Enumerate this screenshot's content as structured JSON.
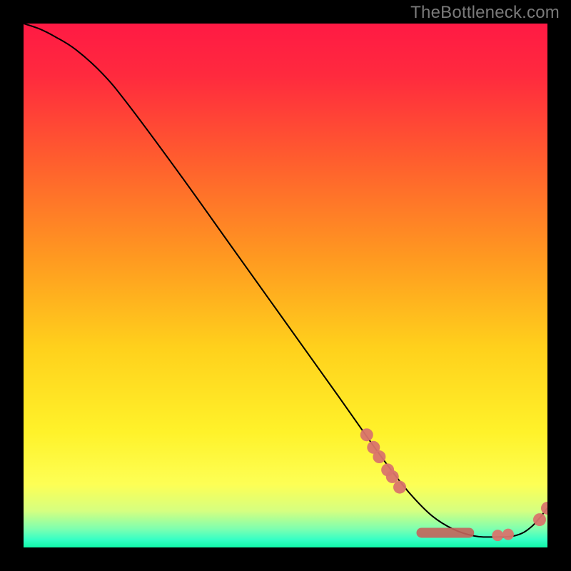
{
  "watermark": "TheBottleneck.com",
  "chart_data": {
    "type": "line",
    "title": "",
    "xlabel": "",
    "ylabel": "",
    "xlim": [
      0,
      100
    ],
    "ylim": [
      0,
      100
    ],
    "grid": false,
    "legend": false,
    "background_gradient_stops": [
      {
        "pos": 0.0,
        "color": "#ff1a44"
      },
      {
        "pos": 0.1,
        "color": "#ff2a3e"
      },
      {
        "pos": 0.25,
        "color": "#ff5a2f"
      },
      {
        "pos": 0.45,
        "color": "#ff9a20"
      },
      {
        "pos": 0.62,
        "color": "#ffd11c"
      },
      {
        "pos": 0.78,
        "color": "#fff22a"
      },
      {
        "pos": 0.88,
        "color": "#fdff55"
      },
      {
        "pos": 0.93,
        "color": "#d6ff80"
      },
      {
        "pos": 0.965,
        "color": "#7dffb0"
      },
      {
        "pos": 0.985,
        "color": "#36ffc5"
      },
      {
        "pos": 1.0,
        "color": "#10f7a8"
      }
    ],
    "series": [
      {
        "name": "bottleneck-curve",
        "color": "#000000",
        "x": [
          0,
          3,
          6,
          10,
          15,
          20,
          30,
          40,
          50,
          60,
          66,
          70,
          74,
          78,
          82,
          86,
          90,
          94,
          97,
          100
        ],
        "y": [
          100,
          99,
          97.5,
          95,
          90.5,
          84.5,
          71,
          57,
          43,
          29,
          20.5,
          15,
          10,
          6,
          3.5,
          2.2,
          2,
          2.3,
          4,
          7.5
        ]
      }
    ],
    "markers": [
      {
        "name": "marker-cluster-a",
        "color": "#d9746c",
        "radius": 9,
        "points": [
          {
            "x": 65.5,
            "y": 21.5
          },
          {
            "x": 66.8,
            "y": 19.1
          },
          {
            "x": 67.9,
            "y": 17.3
          },
          {
            "x": 69.5,
            "y": 14.8
          },
          {
            "x": 70.4,
            "y": 13.5
          },
          {
            "x": 71.8,
            "y": 11.5
          }
        ]
      },
      {
        "name": "flat-annotation-label",
        "color": "#c4635b",
        "height": 14,
        "band": {
          "x0": 75,
          "x1": 86,
          "y": 2.8
        }
      },
      {
        "name": "marker-cluster-b",
        "color": "#d9746c",
        "radius": 8,
        "points": [
          {
            "x": 90.5,
            "y": 2.3
          },
          {
            "x": 92.5,
            "y": 2.5
          }
        ]
      },
      {
        "name": "marker-cluster-c",
        "color": "#d9746c",
        "radius": 9,
        "points": [
          {
            "x": 98.5,
            "y": 5.3
          },
          {
            "x": 100.0,
            "y": 7.5
          }
        ]
      }
    ]
  }
}
